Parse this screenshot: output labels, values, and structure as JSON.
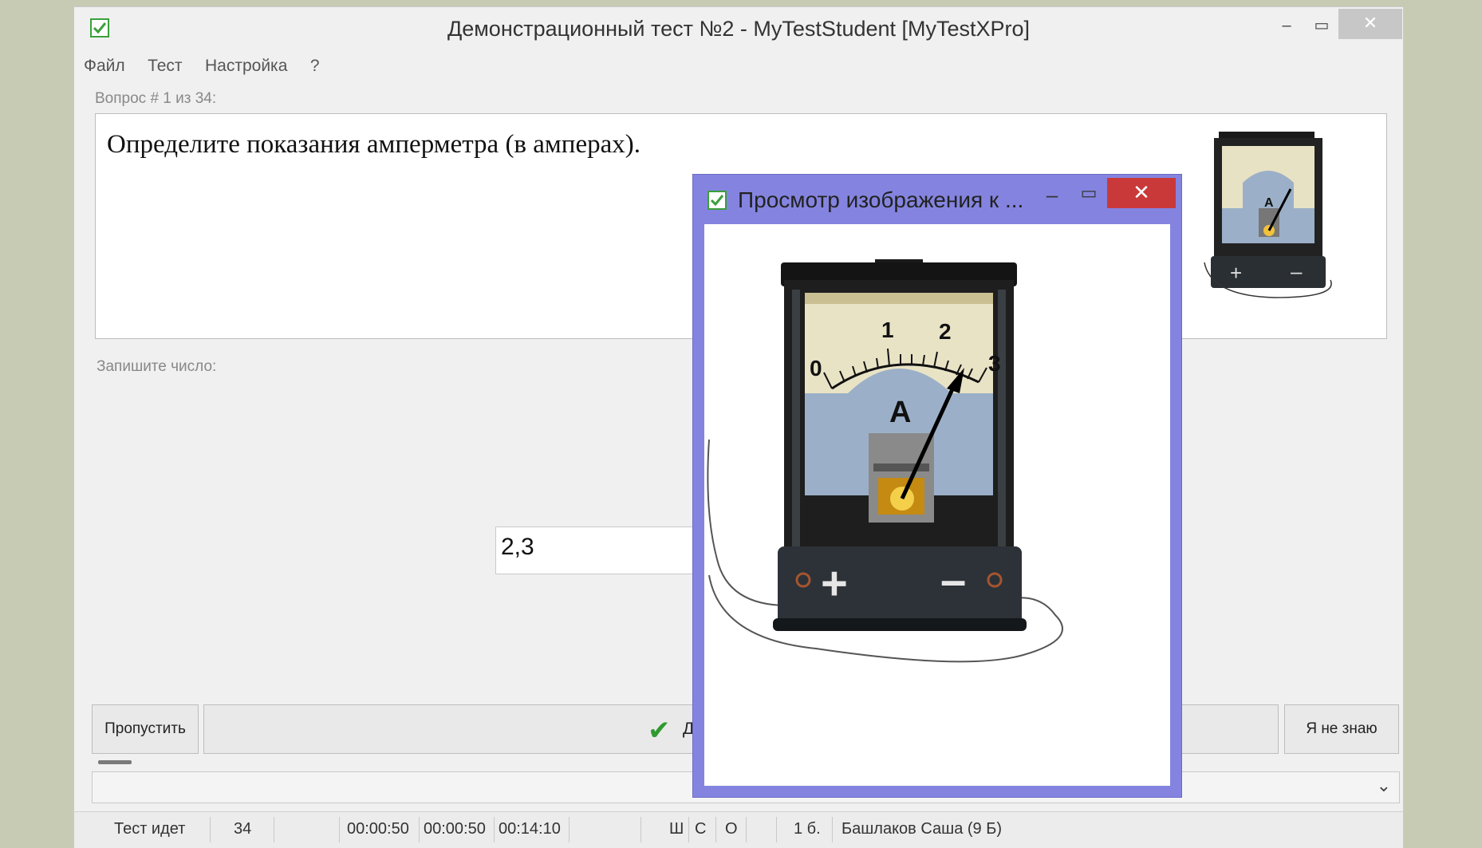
{
  "window": {
    "title": "Демонстрационный тест №2 - MyTestStudent [MyTestXPro]",
    "minimize": "–",
    "maximize": "▭",
    "close": "✕"
  },
  "menu": [
    "Файл",
    "Тест",
    "Настройка",
    "?"
  ],
  "question": {
    "counter": "Вопрос # 1 из 34:",
    "text": "Определите показания амперметра (в амперах)."
  },
  "answer": {
    "label": "Запишите число:",
    "value": "2,3"
  },
  "buttons": {
    "skip": "Пропустить",
    "submit_partial": "Да",
    "dont_know": "Я не знаю"
  },
  "status": {
    "state": "Тест идет",
    "count": "34",
    "time1": "00:00:50",
    "time2": "00:00:50",
    "time3": "00:14:10",
    "flag_sh": "Ш",
    "flag_s": "С",
    "flag_o": "О",
    "score": "1 б.",
    "student": "Башлаков Саша (9 Б)"
  },
  "popup": {
    "title": "Просмотр изображения к ...",
    "minimize": "–",
    "maximize": "▭",
    "close": "✕"
  },
  "ammeter": {
    "scale_labels": [
      "0",
      "1",
      "2",
      "3"
    ],
    "unit": "A",
    "terminal_plus": "+",
    "terminal_minus": "–"
  },
  "colors": {
    "popup_frame": "#8484e0",
    "close_red": "#c9393a",
    "check_green": "#2f9a2f"
  }
}
